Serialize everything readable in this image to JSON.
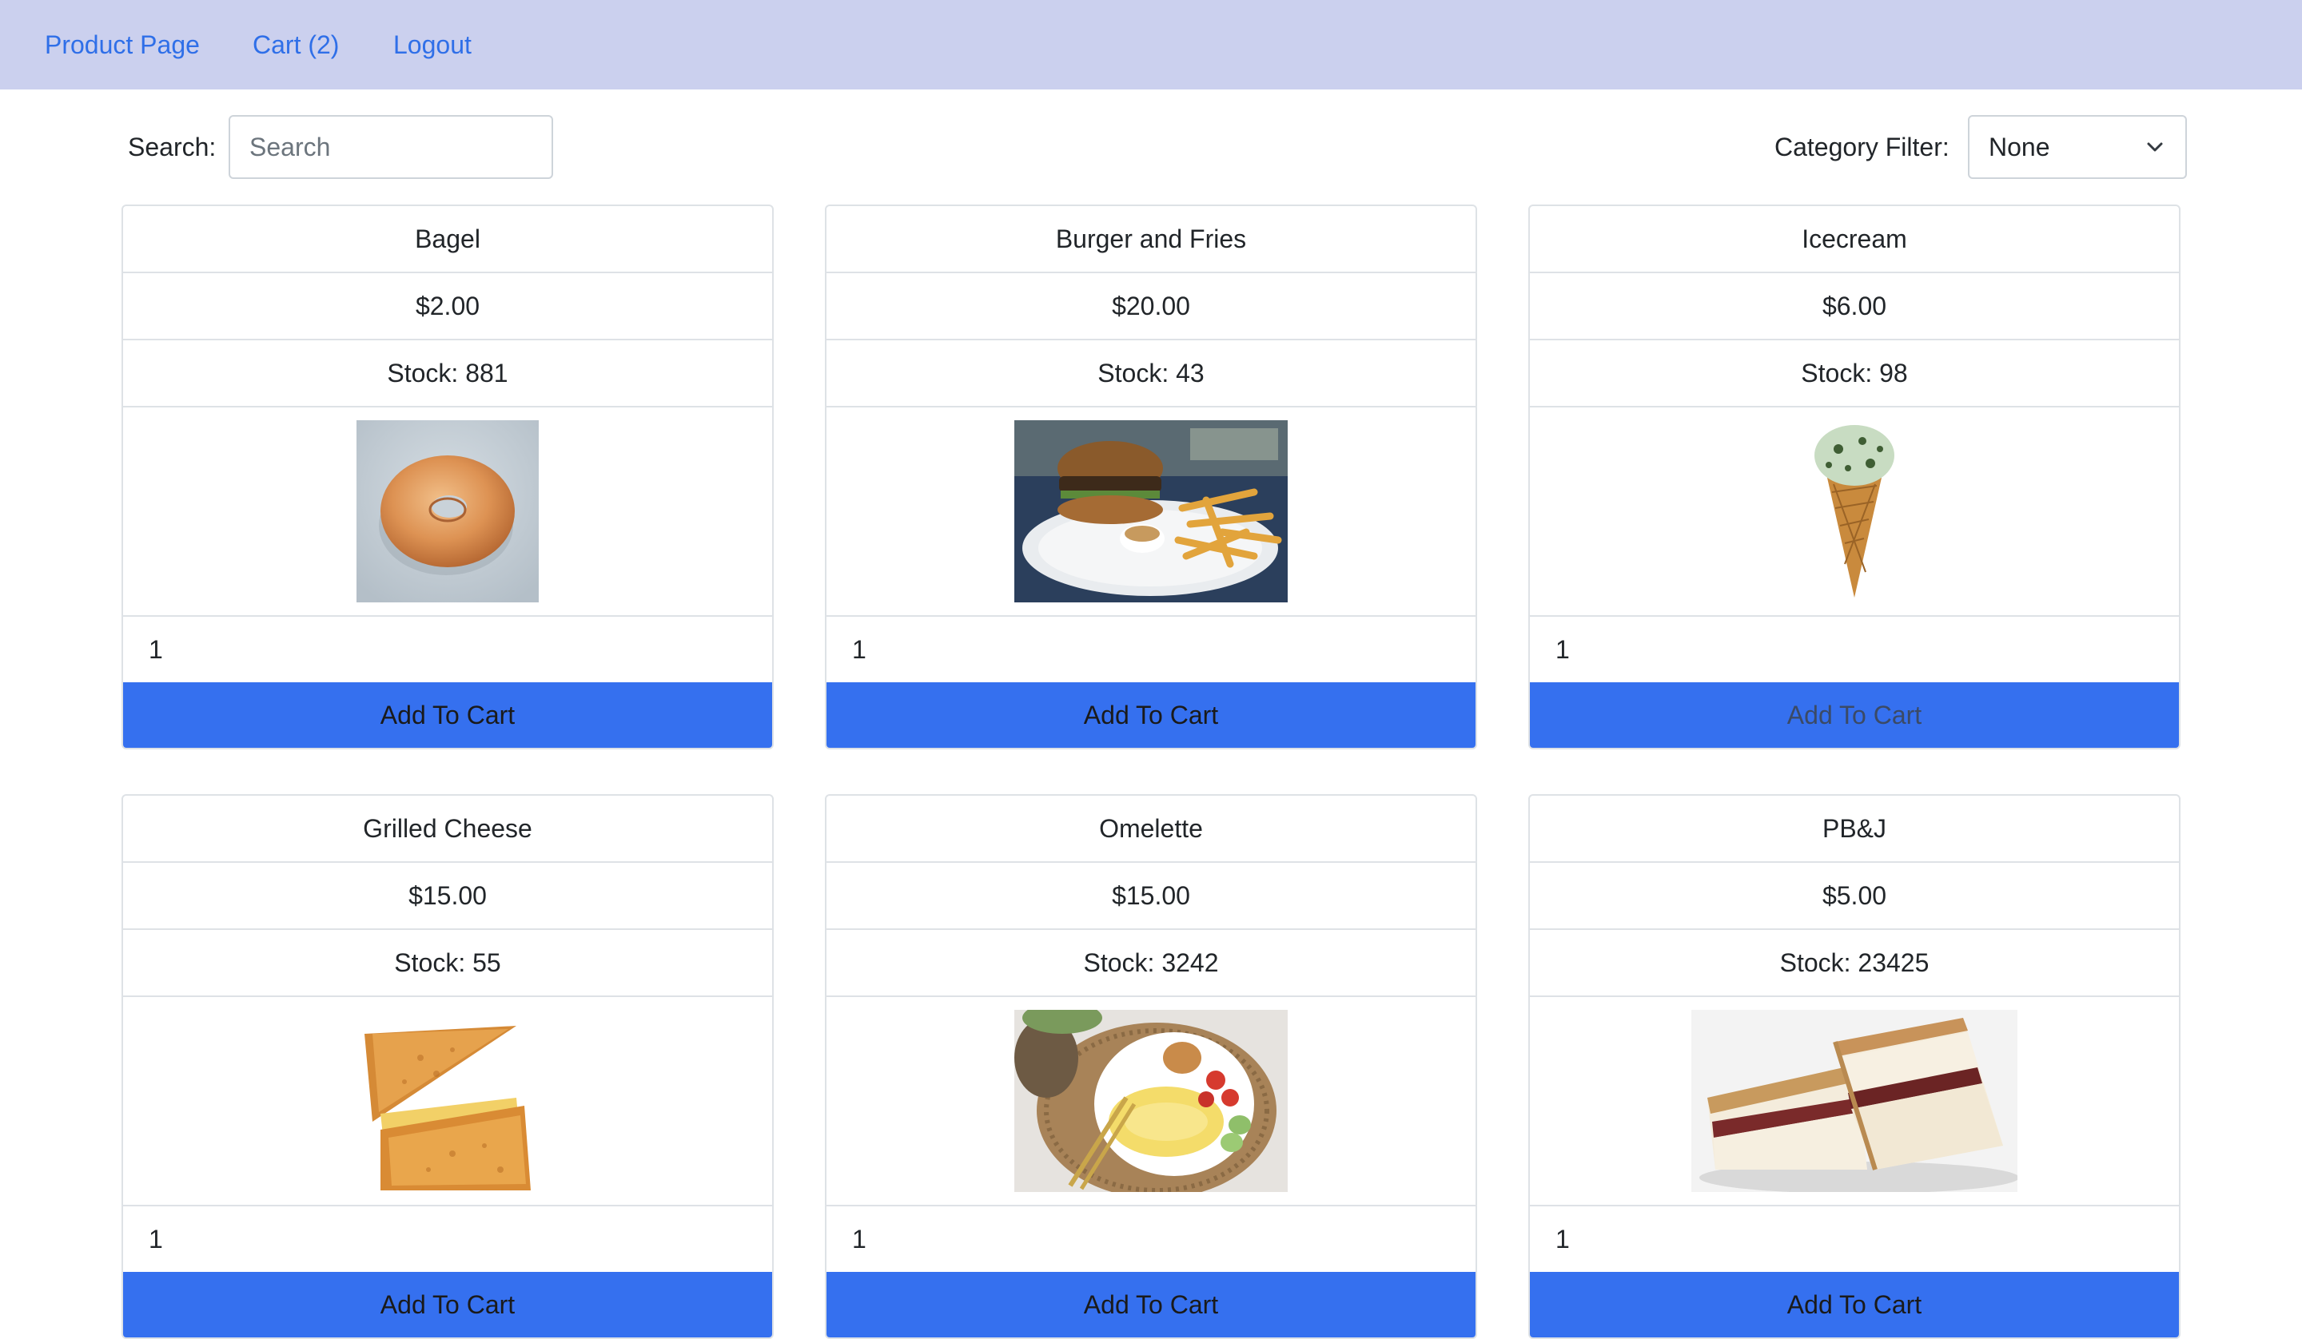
{
  "nav": {
    "links": [
      {
        "label": "Product Page"
      },
      {
        "label": "Cart (2)"
      },
      {
        "label": "Logout"
      }
    ]
  },
  "search": {
    "label": "Search:",
    "placeholder": "Search",
    "value": ""
  },
  "filter": {
    "label": "Category Filter:",
    "selected": "None"
  },
  "colors": {
    "nav_bg": "#cbd0ee",
    "link": "#2f6fe8",
    "button_bg": "#3570ef",
    "border": "#dee2e6"
  },
  "products": [
    {
      "name": "Bagel",
      "price": "$2.00",
      "stock": "Stock: 881",
      "image": "bagel-image",
      "quantity": "1",
      "button": "Add To Cart"
    },
    {
      "name": "Burger and Fries",
      "price": "$20.00",
      "stock": "Stock: 43",
      "image": "burger-and-fries-image",
      "quantity": "1",
      "button": "Add To Cart"
    },
    {
      "name": "Icecream",
      "price": "$6.00",
      "stock": "Stock: 98",
      "image": "icecream-cone-image",
      "quantity": "1",
      "button": "Add To Cart"
    },
    {
      "name": "Grilled Cheese",
      "price": "$15.00",
      "stock": "Stock: 55",
      "image": "grilled-cheese-image",
      "quantity": "1",
      "button": "Add To Cart"
    },
    {
      "name": "Omelette",
      "price": "$15.00",
      "stock": "Stock: 3242",
      "image": "omelette-image",
      "quantity": "1",
      "button": "Add To Cart"
    },
    {
      "name": "PB&J",
      "price": "$5.00",
      "stock": "Stock: 23425",
      "image": "pbj-sandwich-image",
      "quantity": "1",
      "button": "Add To Cart"
    }
  ]
}
